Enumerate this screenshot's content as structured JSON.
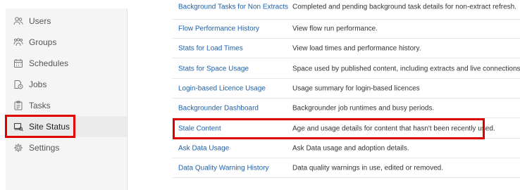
{
  "sidebar": {
    "items": [
      {
        "label": "Users",
        "icon": "users-icon"
      },
      {
        "label": "Groups",
        "icon": "groups-icon"
      },
      {
        "label": "Schedules",
        "icon": "calendar-icon"
      },
      {
        "label": "Jobs",
        "icon": "jobs-icon"
      },
      {
        "label": "Tasks",
        "icon": "clipboard-icon"
      },
      {
        "label": "Site Status",
        "icon": "site-status-icon",
        "active": true
      },
      {
        "label": "Settings",
        "icon": "gear-icon"
      }
    ]
  },
  "status_table": {
    "rows": [
      {
        "name": "Background Tasks for Non Extracts",
        "description": "Completed and pending background task details for non-extract refresh."
      },
      {
        "name": "Flow Performance History",
        "description": "View flow run performance."
      },
      {
        "name": "Stats for Load Times",
        "description": "View load times and performance history."
      },
      {
        "name": "Stats for Space Usage",
        "description": "Space used by published content, including extracts and live connections."
      },
      {
        "name": "Login-based Licence Usage",
        "description": "Usage summary for login-based licences"
      },
      {
        "name": "Backgrounder Dashboard",
        "description": "Backgrounder job runtimes and busy periods."
      },
      {
        "name": "Stale Content",
        "description": "Age and usage details for content that hasn't been recently used."
      },
      {
        "name": "Ask Data Usage",
        "description": "Ask Data usage and adoption details."
      },
      {
        "name": "Data Quality Warning History",
        "description": "Data quality warnings in use, edited or removed."
      }
    ]
  },
  "colors": {
    "highlight": "#e00000",
    "link": "#1f5fa8"
  }
}
